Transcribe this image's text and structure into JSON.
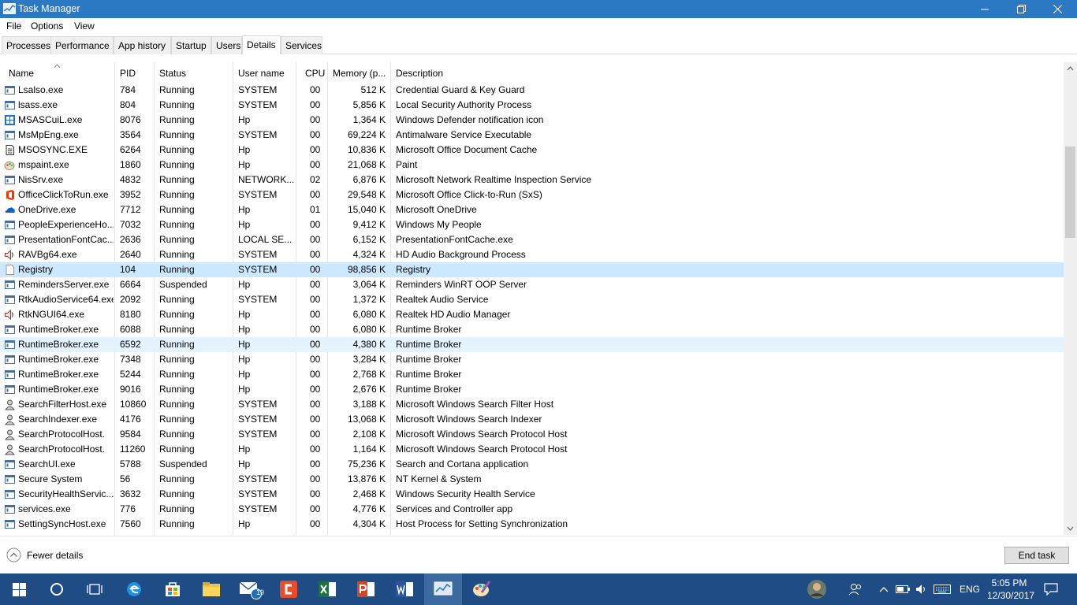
{
  "window": {
    "title": "Task Manager"
  },
  "menu": [
    "File",
    "Options",
    "View"
  ],
  "tabs": [
    "Processes",
    "Performance",
    "App history",
    "Startup",
    "Users",
    "Details",
    "Services"
  ],
  "active_tab": "Details",
  "columns": [
    "Name",
    "PID",
    "Status",
    "User name",
    "CPU",
    "Memory (p...",
    "Description"
  ],
  "rows": [
    {
      "name": "Lsalso.exe",
      "pid": "784",
      "status": "Running",
      "user": "SYSTEM",
      "cpu": "00",
      "mem": "512 K",
      "desc": "Credential Guard & Key Guard",
      "icon": "window-icon"
    },
    {
      "name": "lsass.exe",
      "pid": "804",
      "status": "Running",
      "user": "SYSTEM",
      "cpu": "00",
      "mem": "5,856 K",
      "desc": "Local Security Authority Process",
      "icon": "window-icon"
    },
    {
      "name": "MSASCuiL.exe",
      "pid": "8076",
      "status": "Running",
      "user": "Hp",
      "cpu": "00",
      "mem": "1,364 K",
      "desc": "Windows Defender notification icon",
      "icon": "defender-icon"
    },
    {
      "name": "MsMpEng.exe",
      "pid": "3564",
      "status": "Running",
      "user": "SYSTEM",
      "cpu": "00",
      "mem": "69,224 K",
      "desc": "Antimalware Service Executable",
      "icon": "window-icon"
    },
    {
      "name": "MSOSYNC.EXE",
      "pid": "6264",
      "status": "Running",
      "user": "Hp",
      "cpu": "00",
      "mem": "10,836 K",
      "desc": "Microsoft Office Document Cache",
      "icon": "document-icon"
    },
    {
      "name": "mspaint.exe",
      "pid": "1860",
      "status": "Running",
      "user": "Hp",
      "cpu": "00",
      "mem": "21,068 K",
      "desc": "Paint",
      "icon": "paint-icon"
    },
    {
      "name": "NisSrv.exe",
      "pid": "4832",
      "status": "Running",
      "user": "NETWORK...",
      "cpu": "02",
      "mem": "6,876 K",
      "desc": "Microsoft Network Realtime Inspection Service",
      "icon": "window-icon"
    },
    {
      "name": "OfficeClickToRun.exe",
      "pid": "3952",
      "status": "Running",
      "user": "SYSTEM",
      "cpu": "00",
      "mem": "29,548 K",
      "desc": "Microsoft Office Click-to-Run (SxS)",
      "icon": "office-icon"
    },
    {
      "name": "OneDrive.exe",
      "pid": "7712",
      "status": "Running",
      "user": "Hp",
      "cpu": "01",
      "mem": "15,040 K",
      "desc": "Microsoft OneDrive",
      "icon": "onedrive-icon"
    },
    {
      "name": "PeopleExperienceHo...",
      "pid": "7032",
      "status": "Running",
      "user": "Hp",
      "cpu": "00",
      "mem": "9,412 K",
      "desc": "Windows My People",
      "icon": "window-icon"
    },
    {
      "name": "PresentationFontCac...",
      "pid": "2636",
      "status": "Running",
      "user": "LOCAL SE...",
      "cpu": "00",
      "mem": "6,152 K",
      "desc": "PresentationFontCache.exe",
      "icon": "window-icon"
    },
    {
      "name": "RAVBg64.exe",
      "pid": "2640",
      "status": "Running",
      "user": "SYSTEM",
      "cpu": "00",
      "mem": "4,324 K",
      "desc": "HD Audio Background Process",
      "icon": "speaker-icon"
    },
    {
      "name": "Registry",
      "pid": "104",
      "status": "Running",
      "user": "SYSTEM",
      "cpu": "00",
      "mem": "98,856 K",
      "desc": "Registry",
      "icon": "blank-page-icon"
    },
    {
      "name": "RemindersServer.exe",
      "pid": "6664",
      "status": "Suspended",
      "user": "Hp",
      "cpu": "00",
      "mem": "3,064 K",
      "desc": "Reminders WinRT OOP Server",
      "icon": "window-icon"
    },
    {
      "name": "RtkAudioService64.exe",
      "pid": "2092",
      "status": "Running",
      "user": "SYSTEM",
      "cpu": "00",
      "mem": "1,372 K",
      "desc": "Realtek Audio Service",
      "icon": "window-icon"
    },
    {
      "name": "RtkNGUI64.exe",
      "pid": "8180",
      "status": "Running",
      "user": "Hp",
      "cpu": "00",
      "mem": "6,080 K",
      "desc": "Realtek HD Audio Manager",
      "icon": "speaker-icon"
    },
    {
      "name": "RuntimeBroker.exe",
      "pid": "6088",
      "status": "Running",
      "user": "Hp",
      "cpu": "00",
      "mem": "6,080 K",
      "desc": "Runtime Broker",
      "icon": "window-icon"
    },
    {
      "name": "RuntimeBroker.exe",
      "pid": "6592",
      "status": "Running",
      "user": "Hp",
      "cpu": "00",
      "mem": "4,380 K",
      "desc": "Runtime Broker",
      "icon": "window-icon"
    },
    {
      "name": "RuntimeBroker.exe",
      "pid": "7348",
      "status": "Running",
      "user": "Hp",
      "cpu": "00",
      "mem": "3,284 K",
      "desc": "Runtime Broker",
      "icon": "window-icon"
    },
    {
      "name": "RuntimeBroker.exe",
      "pid": "5244",
      "status": "Running",
      "user": "Hp",
      "cpu": "00",
      "mem": "2,768 K",
      "desc": "Runtime Broker",
      "icon": "window-icon"
    },
    {
      "name": "RuntimeBroker.exe",
      "pid": "9016",
      "status": "Running",
      "user": "Hp",
      "cpu": "00",
      "mem": "2,676 K",
      "desc": "Runtime Broker",
      "icon": "window-icon"
    },
    {
      "name": "SearchFilterHost.exe",
      "pid": "10860",
      "status": "Running",
      "user": "SYSTEM",
      "cpu": "00",
      "mem": "3,188 K",
      "desc": "Microsoft Windows Search Filter Host",
      "icon": "search-user-icon"
    },
    {
      "name": "SearchIndexer.exe",
      "pid": "4176",
      "status": "Running",
      "user": "SYSTEM",
      "cpu": "00",
      "mem": "13,068 K",
      "desc": "Microsoft Windows Search Indexer",
      "icon": "search-user-icon"
    },
    {
      "name": "SearchProtocolHost.",
      "pid": "9584",
      "status": "Running",
      "user": "SYSTEM",
      "cpu": "00",
      "mem": "2,108 K",
      "desc": "Microsoft Windows Search Protocol Host",
      "icon": "search-user-icon"
    },
    {
      "name": "SearchProtocolHost.",
      "pid": "11260",
      "status": "Running",
      "user": "Hp",
      "cpu": "00",
      "mem": "1,164 K",
      "desc": "Microsoft Windows Search Protocol Host",
      "icon": "search-user-icon"
    },
    {
      "name": "SearchUI.exe",
      "pid": "5788",
      "status": "Suspended",
      "user": "Hp",
      "cpu": "00",
      "mem": "75,236 K",
      "desc": "Search and Cortana application",
      "icon": "window-icon"
    },
    {
      "name": "Secure System",
      "pid": "56",
      "status": "Running",
      "user": "SYSTEM",
      "cpu": "00",
      "mem": "13,876 K",
      "desc": "NT Kernel & System",
      "icon": "window-icon"
    },
    {
      "name": "SecurityHealthServic...",
      "pid": "3632",
      "status": "Running",
      "user": "SYSTEM",
      "cpu": "00",
      "mem": "2,468 K",
      "desc": "Windows Security Health Service",
      "icon": "window-icon"
    },
    {
      "name": "services.exe",
      "pid": "776",
      "status": "Running",
      "user": "SYSTEM",
      "cpu": "00",
      "mem": "4,776 K",
      "desc": "Services and Controller app",
      "icon": "window-icon"
    },
    {
      "name": "SettingSyncHost.exe",
      "pid": "7560",
      "status": "Running",
      "user": "Hp",
      "cpu": "00",
      "mem": "4,304 K",
      "desc": "Host Process for Setting Synchronization",
      "icon": "window-icon"
    }
  ],
  "selected_row": "Registry",
  "hover_row": "6592",
  "footer": {
    "fewer_details": "Fewer details",
    "end_task": "End task"
  },
  "taskbar": {
    "mail_badge": "19",
    "language": "ENG",
    "time": "5:05 PM",
    "date": "12/30/2017"
  },
  "colors": {
    "titlebar": "#2b79c2",
    "taskbar": "#1f4c84",
    "selected": "#cce8ff",
    "hover": "#e5f3ff"
  }
}
